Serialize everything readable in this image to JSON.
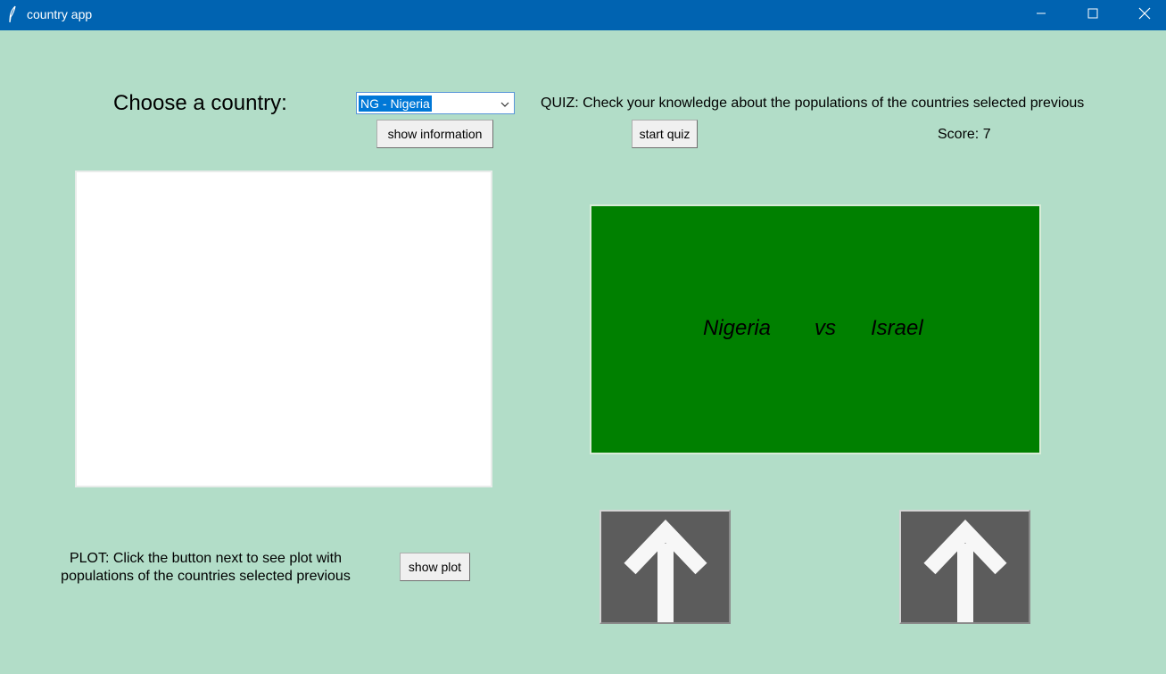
{
  "window": {
    "title": "country app",
    "app_icon": "feather-icon",
    "controls": [
      "minimize-icon",
      "maximize-icon",
      "close-icon"
    ]
  },
  "country_select": {
    "label": "Choose a country:",
    "selected": "NG - Nigeria",
    "show_info_label": "show information"
  },
  "quiz": {
    "description": "QUIZ: Check your knowledge about the populations of the countries selected previous",
    "start_label": "start quiz",
    "score_text": "Score: 7",
    "country_a": "Nigeria",
    "vs_text": "vs",
    "country_b": "Israel",
    "panel_color": "#008000",
    "answer_buttons": [
      "arrow-up-icon",
      "arrow-up-icon"
    ]
  },
  "plot": {
    "description": "PLOT: Click the button next to see plot with populations of the countries selected previous",
    "line1": "PLOT: Click the button next to see plot with",
    "line2": "populations of the countries selected previous",
    "button_label": "show plot"
  },
  "info_panel": {
    "text": ""
  },
  "colors": {
    "background": "#b2ddc8",
    "titlebar": "#0063b1",
    "arrow_button": "#5c5c5c"
  }
}
